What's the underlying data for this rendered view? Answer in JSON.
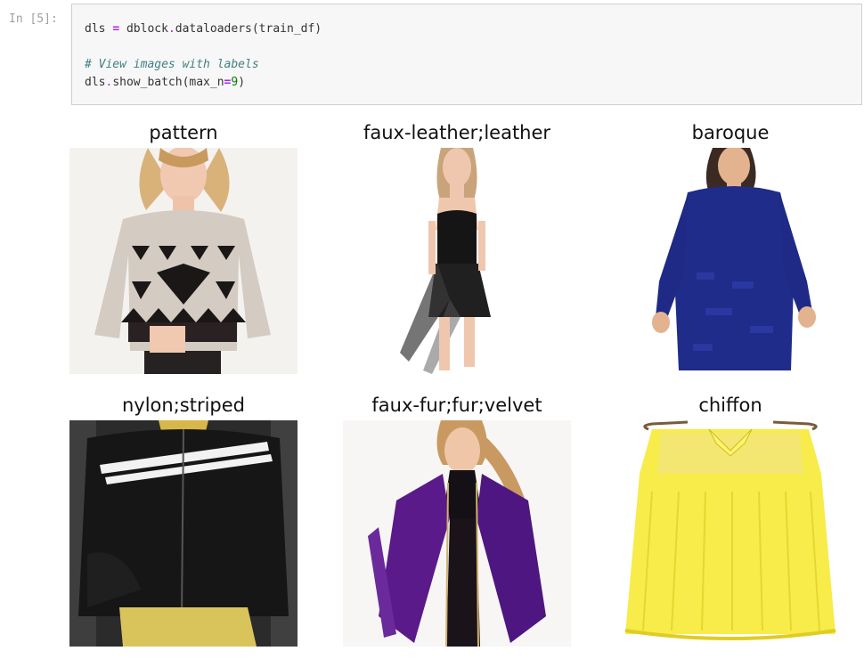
{
  "cell": {
    "prompt": "In [5]:",
    "code_line1": {
      "a": "dls ",
      "op": "=",
      "b": " dblock",
      "dot": ".",
      "c": "dataloaders(train_df)"
    },
    "comment": "# View images with labels",
    "code_line3": {
      "a": "dls",
      "dot": ".",
      "b": "show_batch(max_n",
      "op": "=",
      "num": "9",
      "c": ")"
    }
  },
  "batch": [
    {
      "label": "pattern",
      "image": "knit-sweater-geometric-pattern"
    },
    {
      "label": "faux-leather;leather",
      "image": "black-high-low-dress"
    },
    {
      "label": "baroque",
      "image": "blue-velvet-dress"
    },
    {
      "label": "nylon;striped",
      "image": "black-striped-jacket"
    },
    {
      "label": "faux-fur;fur;velvet",
      "image": "purple-fur-jacket"
    },
    {
      "label": "chiffon",
      "image": "yellow-chiffon-top"
    }
  ]
}
